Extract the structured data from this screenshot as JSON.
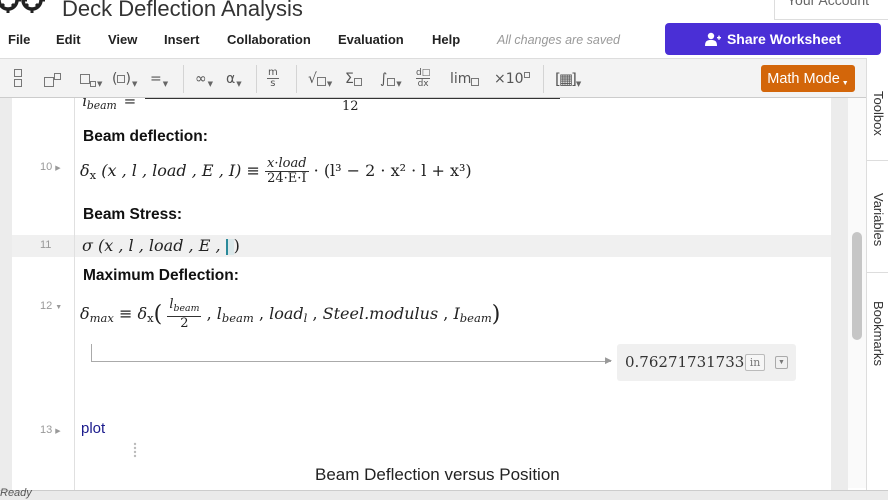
{
  "app": {
    "doc_title": "Deck Deflection Analysis",
    "account_label": "Your Account"
  },
  "menu": {
    "items": [
      "File",
      "Edit",
      "View",
      "Insert",
      "Collaboration",
      "Evaluation",
      "Help"
    ],
    "saved_note": "All changes are saved",
    "share_label": "Share Worksheet"
  },
  "toolbar": {
    "inf": "∞",
    "alpha": "α",
    "units_top": "m",
    "units_bot": "s",
    "sqrt": "√",
    "sum": "Σ",
    "integral": "∫",
    "deriv_top": "d□",
    "deriv_bot": "dx",
    "lim": "lim",
    "sci": "×10",
    "equals": "=",
    "math_mode": "Math Mode"
  },
  "sidetabs": [
    "Toolbox",
    "Variables",
    "Bookmarks"
  ],
  "worksheet": {
    "partial_top": {
      "lhs_sub": "beam",
      "rhs_den": "12"
    },
    "regions": [
      {
        "num": "10",
        "heading": "Beam deflection:"
      },
      {
        "num": "11",
        "heading": "Beam Stress:"
      },
      {
        "num": "12",
        "heading": "Maximum Deflection:"
      },
      {
        "num": "13",
        "heading": ""
      }
    ],
    "deflection": {
      "fn": "δ",
      "sub": "x",
      "args": "(x , l , load , E , I)",
      "def": "≡",
      "frac_num": "x·load",
      "frac_den": "24·E·I",
      "tail": "· (l³ − 2 · x² · l + x³)"
    },
    "stress": {
      "fn": "σ",
      "args": "(x , l , load , E , "
    },
    "maxdef": {
      "lhs": "δ",
      "lhs_sub": "max",
      "def": "≡",
      "call": "δ",
      "call_sub": "x",
      "frac_num": "l",
      "frac_num_sub": "beam",
      "frac_den": "2",
      "arg2": "l",
      "arg2_sub": "beam",
      "arg3": "load",
      "arg3_sub": "l",
      "arg4": "Steel.modulus",
      "arg5": "I",
      "arg5_sub": "beam"
    },
    "result": {
      "value": "0.762717317337",
      "unit": "in"
    },
    "plot_cmd": "plot",
    "plot_title": "Beam Deflection versus Position"
  },
  "status": "Ready"
}
